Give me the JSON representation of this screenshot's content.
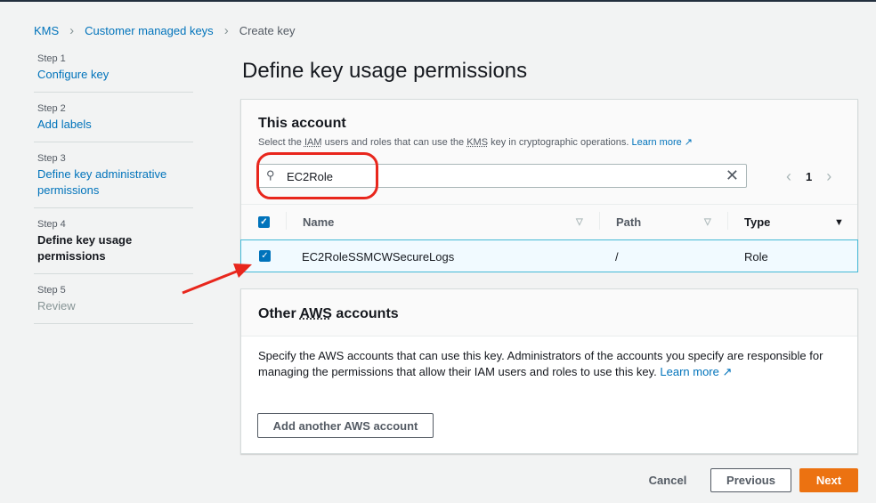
{
  "breadcrumb": {
    "items": [
      "KMS",
      "Customer managed keys"
    ],
    "current": "Create key"
  },
  "steps": [
    {
      "num": "Step 1",
      "label": "Configure key"
    },
    {
      "num": "Step 2",
      "label": "Add labels"
    },
    {
      "num": "Step 3",
      "label": "Define key administrative permissions"
    },
    {
      "num": "Step 4",
      "label": "Define key usage permissions"
    },
    {
      "num": "Step 5",
      "label": "Review"
    }
  ],
  "page_title": "Define key usage permissions",
  "this_account": {
    "title": "This account",
    "desc_1": "Select the ",
    "iam": "IAM",
    "desc_2": " users and roles that can use the ",
    "kms": "KMS",
    "desc_3": " key in cryptographic operations. ",
    "learn_more": "Learn more",
    "search_value": "EC2Role",
    "page": "1",
    "columns": [
      "Name",
      "Path",
      "Type"
    ],
    "rows": [
      {
        "name": "EC2RoleSSMCWSecureLogs",
        "path": "/",
        "type": "Role",
        "selected": true
      }
    ]
  },
  "other_accounts": {
    "title_1": "Other ",
    "aws": "AWS",
    "title_2": " accounts",
    "text": "Specify the AWS accounts that can use this key. Administrators of the accounts you specify are responsible for managing the permissions that allow their IAM users and roles to use this key. ",
    "learn_more": "Learn more",
    "add_button": "Add another AWS account"
  },
  "footer": {
    "cancel": "Cancel",
    "previous": "Previous",
    "next": "Next"
  },
  "colors": {
    "accent": "#ec7211",
    "link": "#0073bb",
    "annotation": "#e8261c"
  }
}
